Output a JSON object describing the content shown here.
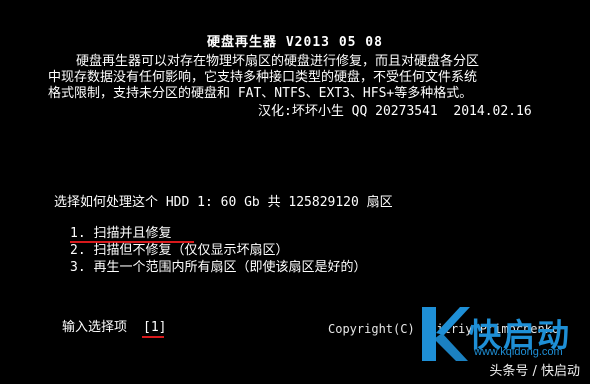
{
  "header": {
    "title": "硬盘再生器 V2013 05 08"
  },
  "description": {
    "line1": "硬盘再生器可以对存在物理坏扇区的硬盘进行修复，而且对硬盘各分区",
    "line2": "中现存数据没有任何影响，它支持多种接口类型的硬盘，不受任何文件系统",
    "line3": "格式限制，支持未分区的硬盘和 FAT、NTFS、EXT3、HFS+等多种格式。",
    "credit": "汉化:坏坏小生 QQ 20273541  2014.02.16"
  },
  "menu": {
    "question": "选择如何处理这个 HDD 1: 60 Gb 共 125829120 扇区",
    "options": [
      "1. 扫描并且修复",
      "2. 扫描但不修复（仅仅显示坏扇区）",
      "3. 再生一个范围内所有扇区（即使该扇区是好的）"
    ]
  },
  "prompt": {
    "label": "输入选择项",
    "value": "[1]"
  },
  "copyright": "Copyright(C) Dmitriy Primochenko",
  "watermark": {
    "brand": "快启动",
    "url": "www.kqidong.com",
    "source_tag": "头条号 / 快启动"
  },
  "colors": {
    "background": "#000000",
    "text": "#ffffff",
    "underline": "#d8191c",
    "watermark": "#1e8fd6"
  }
}
